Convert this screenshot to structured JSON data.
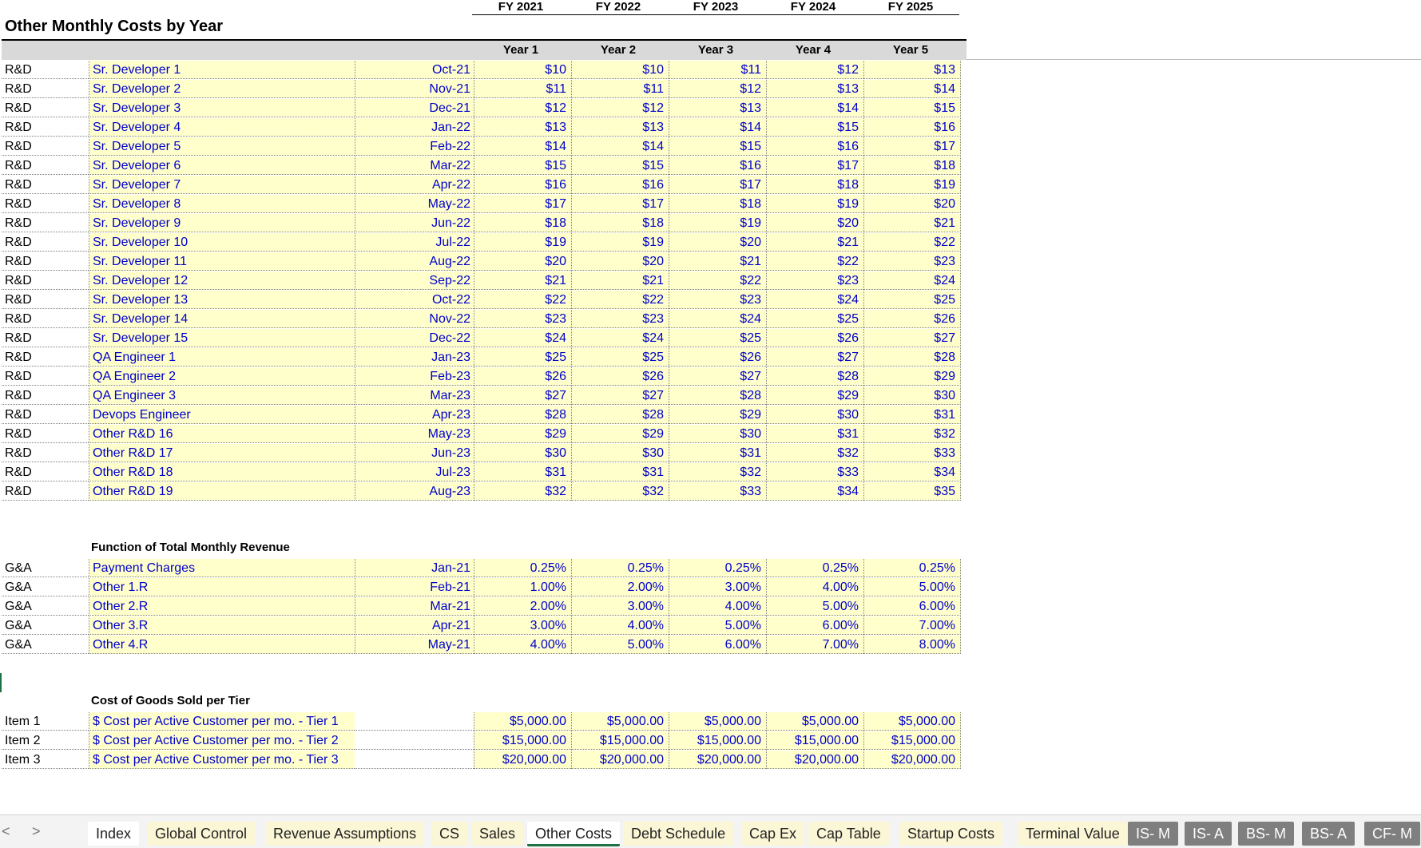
{
  "fy_headers": [
    "FY 2021",
    "FY 2022",
    "FY 2023",
    "FY 2024",
    "FY 2025"
  ],
  "title": "Other Monthly Costs by Year",
  "year_headers": [
    "Year 1",
    "Year 2",
    "Year 3",
    "Year 4",
    "Year 5"
  ],
  "rd_rows": [
    {
      "dept": "R&D",
      "name": "Sr. Developer 1",
      "date": "Oct-21",
      "vals": [
        "$10",
        "$10",
        "$11",
        "$12",
        "$13"
      ]
    },
    {
      "dept": "R&D",
      "name": "Sr. Developer 2",
      "date": "Nov-21",
      "vals": [
        "$11",
        "$11",
        "$12",
        "$13",
        "$14"
      ]
    },
    {
      "dept": "R&D",
      "name": "Sr. Developer 3",
      "date": "Dec-21",
      "vals": [
        "$12",
        "$12",
        "$13",
        "$14",
        "$15"
      ]
    },
    {
      "dept": "R&D",
      "name": "Sr. Developer 4",
      "date": "Jan-22",
      "vals": [
        "$13",
        "$13",
        "$14",
        "$15",
        "$16"
      ]
    },
    {
      "dept": "R&D",
      "name": "Sr. Developer 5",
      "date": "Feb-22",
      "vals": [
        "$14",
        "$14",
        "$15",
        "$16",
        "$17"
      ]
    },
    {
      "dept": "R&D",
      "name": "Sr. Developer 6",
      "date": "Mar-22",
      "vals": [
        "$15",
        "$15",
        "$16",
        "$17",
        "$18"
      ]
    },
    {
      "dept": "R&D",
      "name": "Sr. Developer 7",
      "date": "Apr-22",
      "vals": [
        "$16",
        "$16",
        "$17",
        "$18",
        "$19"
      ]
    },
    {
      "dept": "R&D",
      "name": "Sr. Developer 8",
      "date": "May-22",
      "vals": [
        "$17",
        "$17",
        "$18",
        "$19",
        "$20"
      ]
    },
    {
      "dept": "R&D",
      "name": "Sr. Developer 9",
      "date": "Jun-22",
      "vals": [
        "$18",
        "$18",
        "$19",
        "$20",
        "$21"
      ]
    },
    {
      "dept": "R&D",
      "name": "Sr. Developer 10",
      "date": "Jul-22",
      "vals": [
        "$19",
        "$19",
        "$20",
        "$21",
        "$22"
      ]
    },
    {
      "dept": "R&D",
      "name": "Sr. Developer 11",
      "date": "Aug-22",
      "vals": [
        "$20",
        "$20",
        "$21",
        "$22",
        "$23"
      ]
    },
    {
      "dept": "R&D",
      "name": "Sr. Developer 12",
      "date": "Sep-22",
      "vals": [
        "$21",
        "$21",
        "$22",
        "$23",
        "$24"
      ]
    },
    {
      "dept": "R&D",
      "name": "Sr. Developer 13",
      "date": "Oct-22",
      "vals": [
        "$22",
        "$22",
        "$23",
        "$24",
        "$25"
      ]
    },
    {
      "dept": "R&D",
      "name": "Sr. Developer 14",
      "date": "Nov-22",
      "vals": [
        "$23",
        "$23",
        "$24",
        "$25",
        "$26"
      ]
    },
    {
      "dept": "R&D",
      "name": "Sr. Developer 15",
      "date": "Dec-22",
      "vals": [
        "$24",
        "$24",
        "$25",
        "$26",
        "$27"
      ]
    },
    {
      "dept": "R&D",
      "name": "QA Engineer 1",
      "date": "Jan-23",
      "vals": [
        "$25",
        "$25",
        "$26",
        "$27",
        "$28"
      ]
    },
    {
      "dept": "R&D",
      "name": "QA Engineer 2",
      "date": "Feb-23",
      "vals": [
        "$26",
        "$26",
        "$27",
        "$28",
        "$29"
      ]
    },
    {
      "dept": "R&D",
      "name": "QA Engineer 3",
      "date": "Mar-23",
      "vals": [
        "$27",
        "$27",
        "$28",
        "$29",
        "$30"
      ]
    },
    {
      "dept": "R&D",
      "name": "Devops Engineer",
      "date": "Apr-23",
      "vals": [
        "$28",
        "$28",
        "$29",
        "$30",
        "$31"
      ]
    },
    {
      "dept": "R&D",
      "name": "Other R&D 16",
      "date": "May-23",
      "vals": [
        "$29",
        "$29",
        "$30",
        "$31",
        "$32"
      ]
    },
    {
      "dept": "R&D",
      "name": "Other R&D 17",
      "date": "Jun-23",
      "vals": [
        "$30",
        "$30",
        "$31",
        "$32",
        "$33"
      ]
    },
    {
      "dept": "R&D",
      "name": "Other R&D 18",
      "date": "Jul-23",
      "vals": [
        "$31",
        "$31",
        "$32",
        "$33",
        "$34"
      ]
    },
    {
      "dept": "R&D",
      "name": "Other R&D 19",
      "date": "Aug-23",
      "vals": [
        "$32",
        "$32",
        "$33",
        "$34",
        "$35"
      ]
    }
  ],
  "ga_title": "Function of Total Monthly Revenue",
  "ga_rows": [
    {
      "dept": "G&A",
      "name": "Payment Charges",
      "date": "Jan-21",
      "vals": [
        "0.25%",
        "0.25%",
        "0.25%",
        "0.25%",
        "0.25%"
      ]
    },
    {
      "dept": "G&A",
      "name": "Other 1.R",
      "date": "Feb-21",
      "vals": [
        "1.00%",
        "2.00%",
        "3.00%",
        "4.00%",
        "5.00%"
      ]
    },
    {
      "dept": "G&A",
      "name": "Other 2.R",
      "date": "Mar-21",
      "vals": [
        "2.00%",
        "3.00%",
        "4.00%",
        "5.00%",
        "6.00%"
      ]
    },
    {
      "dept": "G&A",
      "name": "Other 3.R",
      "date": "Apr-21",
      "vals": [
        "3.00%",
        "4.00%",
        "5.00%",
        "6.00%",
        "7.00%"
      ]
    },
    {
      "dept": "G&A",
      "name": "Other 4.R",
      "date": "May-21",
      "vals": [
        "4.00%",
        "5.00%",
        "6.00%",
        "7.00%",
        "8.00%"
      ]
    }
  ],
  "cogs_title": "Cost of Goods Sold per Tier",
  "cogs_rows": [
    {
      "dept": "Item 1",
      "name": "$ Cost per Active Customer per mo. - Tier 1",
      "date": "",
      "vals": [
        "$5,000.00",
        "$5,000.00",
        "$5,000.00",
        "$5,000.00",
        "$5,000.00"
      ]
    },
    {
      "dept": "Item 2",
      "name": "$ Cost per Active Customer per mo. - Tier 2",
      "date": "",
      "vals": [
        "$15,000.00",
        "$15,000.00",
        "$15,000.00",
        "$15,000.00",
        "$15,000.00"
      ]
    },
    {
      "dept": "Item 3",
      "name": "$ Cost per Active Customer per mo. - Tier 3",
      "date": "",
      "vals": [
        "$20,000.00",
        "$20,000.00",
        "$20,000.00",
        "$20,000.00",
        "$20,000.00"
      ]
    }
  ],
  "tabs": [
    {
      "label": "Index",
      "style": "white"
    },
    {
      "label": "Global Control",
      "style": "yellow"
    },
    {
      "label": "Revenue Assumptions",
      "style": "yellow"
    },
    {
      "label": "CS",
      "style": "yellow"
    },
    {
      "label": "Sales",
      "style": "yellow"
    },
    {
      "label": "Other Costs",
      "style": "active"
    },
    {
      "label": "Debt Schedule",
      "style": "yellow"
    },
    {
      "label": "Cap Ex",
      "style": "yellow"
    },
    {
      "label": "Cap Table",
      "style": "yellow"
    },
    {
      "label": "Startup Costs",
      "style": "yellow"
    },
    {
      "label": "Terminal Value",
      "style": "yellow"
    },
    {
      "label": "IS- M",
      "style": "dark"
    },
    {
      "label": "IS- A",
      "style": "dark"
    },
    {
      "label": "BS- M",
      "style": "dark"
    },
    {
      "label": "BS- A",
      "style": "dark"
    },
    {
      "label": "CF- M",
      "style": "dark"
    }
  ],
  "nav": {
    "prev": "<",
    "next": ">"
  }
}
